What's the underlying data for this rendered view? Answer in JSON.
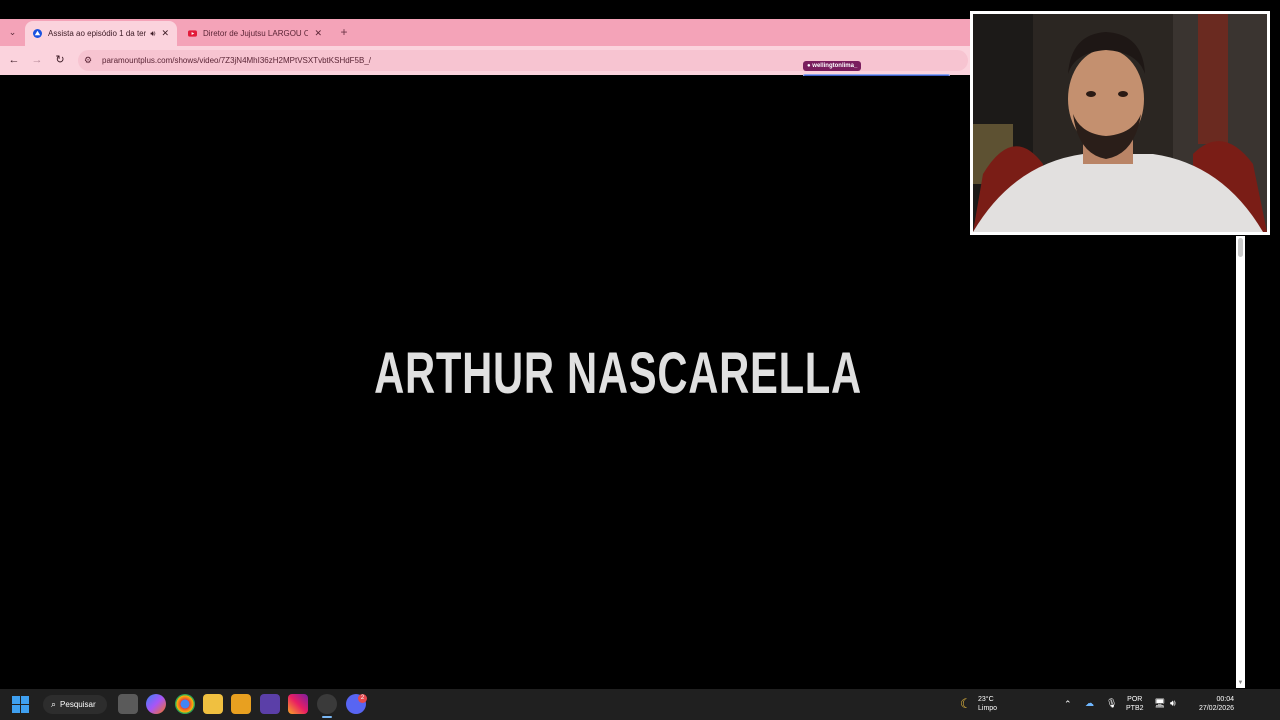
{
  "browser": {
    "tabs": [
      {
        "title": "Assista ao episódio 1 da ter",
        "active": true,
        "audio": true
      },
      {
        "title": "Diretor de Jujutsu LARGOU O A",
        "active": false
      }
    ],
    "url": "paramountplus.com/shows/video/7Z3jN4MhI36zH2MPtVSXTvbtKSHdF5B_/"
  },
  "chat_overlay": {
    "username": "wellingtonlima_",
    "message_icon": "rocket-icon"
  },
  "video": {
    "credit_text": "ARTHUR NASCARELLA"
  },
  "taskbar": {
    "search_label": "Pesquisar",
    "weather": {
      "temp": "23°C",
      "condition": "Limpo"
    },
    "language": {
      "lang": "POR",
      "layout": "PTB2"
    },
    "clock": {
      "time": "00:04",
      "date": "27/02/2026"
    },
    "discord_badge": "2"
  },
  "colors": {
    "tabbar": "#f4a3b8",
    "toolbar": "#fbd3dd",
    "chat_box": "#3d5fc6",
    "chat_user": "#7a1e5e"
  }
}
